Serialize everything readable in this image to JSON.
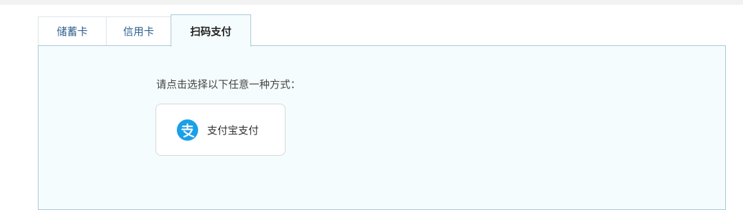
{
  "tabs": [
    {
      "label": "储蓄卡",
      "active": false
    },
    {
      "label": "信用卡",
      "active": false
    },
    {
      "label": "扫码支付",
      "active": true
    }
  ],
  "panel": {
    "prompt": "请点击选择以下任意一种方式：",
    "methods": [
      {
        "label": "支付宝支付",
        "icon": "alipay-icon",
        "icon_color": "#1aa0e8"
      }
    ]
  },
  "colors": {
    "panel_bg": "#f5fcfd",
    "panel_border": "#a9c9d9",
    "tab_text": "#2e5f8f",
    "alipay_blue": "#1aa0e8"
  }
}
